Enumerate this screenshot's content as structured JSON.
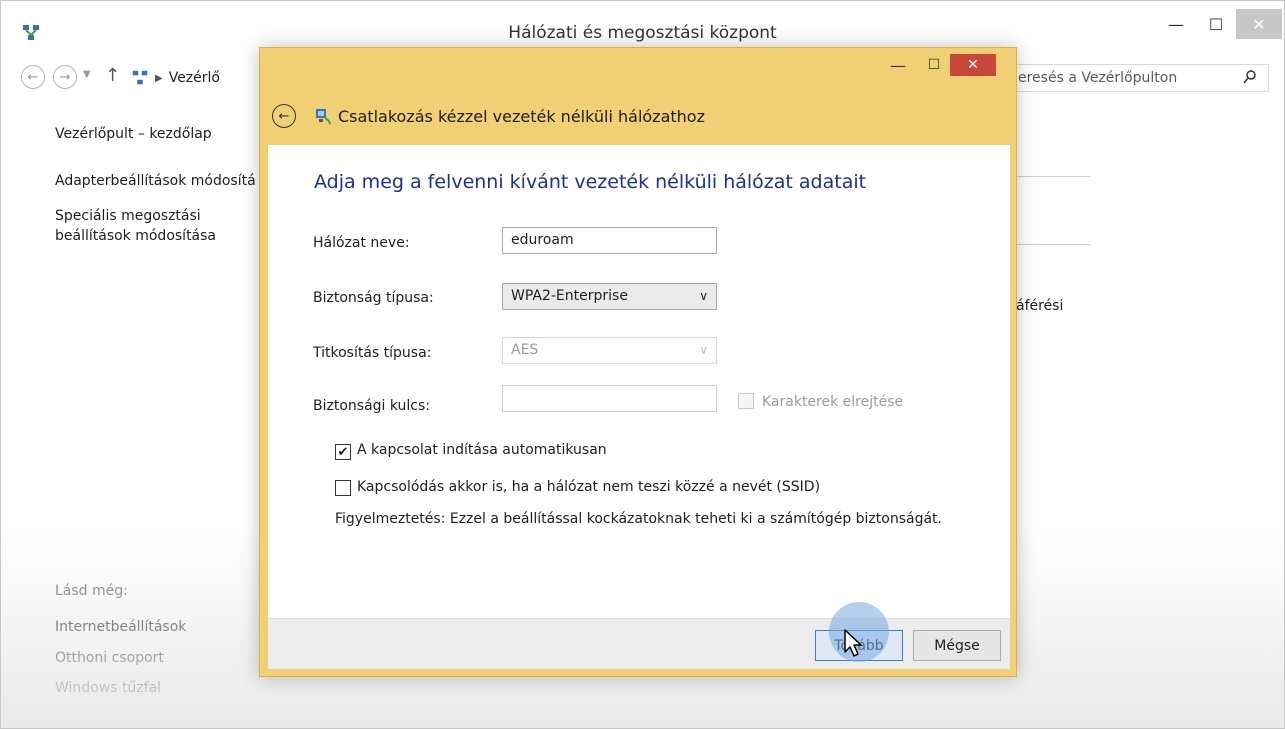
{
  "main_window": {
    "title": "Hálózati és megosztási központ",
    "address_text": "Vezérlő",
    "search_placeholder": "eresés a Vezérlőpulton",
    "sidebar": {
      "home": "Vezérlőpult – kezdőlap",
      "adapter": "Adapterbeállítások módosítá",
      "sharing": "Speciális megosztási beállítások módosítása"
    },
    "see_also": {
      "heading": "Lásd még:",
      "items": [
        "Internetbeállítások",
        "Otthoni csoport",
        "Windows tűzfal"
      ]
    },
    "right_partial_text": "áférési"
  },
  "dialog": {
    "title": "Csatlakozás kézzel vezeték nélküli hálózathoz",
    "heading": "Adja meg a felvenni kívánt vezeték nélküli hálózat adatait",
    "fields": {
      "network_name_label": "Hálózat neve:",
      "network_name_value": "eduroam",
      "security_type_label": "Biztonság típusa:",
      "security_type_value": "WPA2-Enterprise",
      "encryption_type_label": "Titkosítás típusa:",
      "encryption_type_value": "AES",
      "security_key_label": "Biztonsági kulcs:",
      "security_key_value": "",
      "hide_chars_label": "Karakterek elrejtése"
    },
    "options": {
      "auto_connect_label": "A kapcsolat indítása automatikusan",
      "auto_connect_checked": true,
      "connect_hidden_label": "Kapcsolódás akkor is, ha a hálózat nem teszi közzé a nevét (SSID)",
      "connect_hidden_checked": false,
      "warning": "Figyelmeztetés: Ezzel a beállítással kockázatoknak teheti ki a számítógép biztonságát."
    },
    "buttons": {
      "next": "Tovább",
      "cancel": "Mégse"
    }
  },
  "colors": {
    "dialog_frame": "#f1cf75",
    "heading_blue": "#1e3287",
    "close_red": "#c7473b"
  }
}
